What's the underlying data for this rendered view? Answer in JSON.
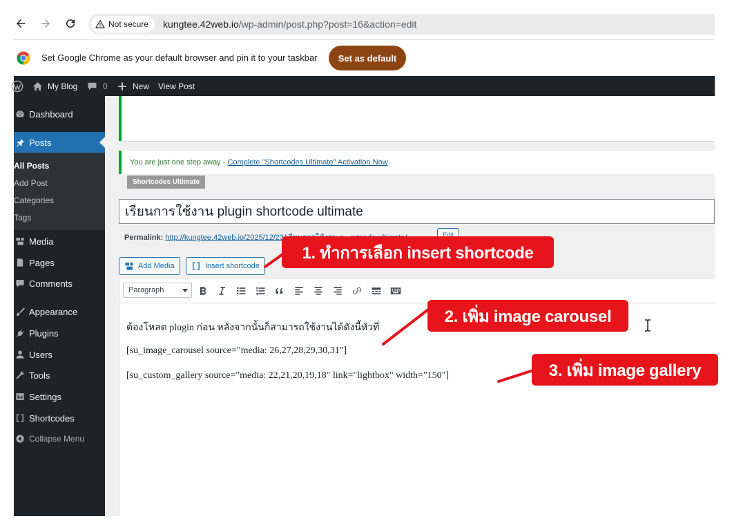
{
  "browser": {
    "security_label": "Not secure",
    "url_host": "kungtee.42web.io",
    "url_path": "/wp-admin/post.php?post=16&action=edit",
    "infobar_text": "Set Google Chrome as your default browser and pin it to your taskbar",
    "set_default_label": "Set as default",
    "accent_color": "#8b4513"
  },
  "adminbar": {
    "site_name": "My Blog",
    "comments_count": "0",
    "new_label": "New",
    "view_post_label": "View Post"
  },
  "sidebar": {
    "items": [
      {
        "label": "Dashboard",
        "icon": "dashboard-icon"
      },
      {
        "label": "Posts",
        "icon": "pin-icon"
      },
      {
        "label": "Media",
        "icon": "media-icon"
      },
      {
        "label": "Pages",
        "icon": "pages-icon"
      },
      {
        "label": "Comments",
        "icon": "comment-icon"
      },
      {
        "label": "Appearance",
        "icon": "brush-icon"
      },
      {
        "label": "Plugins",
        "icon": "plug-icon"
      },
      {
        "label": "Users",
        "icon": "user-icon"
      },
      {
        "label": "Tools",
        "icon": "wrench-icon"
      },
      {
        "label": "Settings",
        "icon": "settings-icon"
      },
      {
        "label": "Shortcodes",
        "icon": "brackets-icon"
      },
      {
        "label": "Collapse Menu",
        "icon": "collapse-icon"
      }
    ],
    "posts_submenu": [
      "All Posts",
      "Add Post",
      "Categories",
      "Tags"
    ],
    "active_color": "#2271b1"
  },
  "notice": {
    "text": "You are just one step away - ",
    "link": "Complete \"Shortcodes Ultimate\" Activation Now",
    "badge": "Shortcodes Ultimate"
  },
  "post": {
    "title": "เรียนการใช้งาน plugin shortcode ultimate",
    "permalink_label": "Permalink:",
    "permalink_url": "http://kungtee.42web.io/2025/12/23/เรียนการใช้งาน-p...ortcode-ultimate/",
    "edit_label": "Edit"
  },
  "editor": {
    "add_media_label": "Add Media",
    "insert_shortcode_label": "Insert shortcode",
    "format_select": "Paragraph",
    "lines": [
      "ต้องโหลด plugin ก่อน หลังจากนั้นก็สามารถใช้งานได้ดังนี้หัวที่",
      "[su_image_carousel source=\"media: 26,27,28,29,30,31\"]",
      "[su_custom_gallery source=\"media: 22,21,20,19,18\" link=\"lightbox\" width=\"150\"]"
    ]
  },
  "annotations": {
    "step1": "1. ทำการเลือก insert shortcode",
    "step2": "2. เพิ่ม image carousel",
    "step3": "3. เพิ่ม image gallery",
    "color": "#e8141b"
  }
}
